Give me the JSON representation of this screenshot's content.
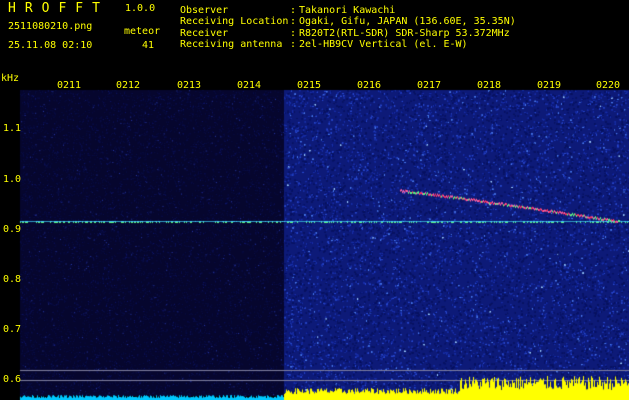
{
  "header": {
    "app_title": "HROFFT",
    "version": "1.0.0",
    "filename": "2511080210.png",
    "timestamp": "25.11.08 02:10",
    "meteor_label": "meteor",
    "meteor_count": "41"
  },
  "info": [
    {
      "label": "Observer",
      "colon": ":",
      "value": "Takanori Kawachi"
    },
    {
      "label": "Receiving Location",
      "colon": ":",
      "value": "Ogaki, Gifu, JAPAN (136.60E, 35.35N)"
    },
    {
      "label": "Receiver",
      "colon": ":",
      "value": "R820T2(RTL-SDR) SDR-Sharp 53.372MHz"
    },
    {
      "label": "Receiving antenna",
      "colon": ":",
      "value": "2el-HB9CV Vertical (el. E-W)"
    }
  ],
  "axis": {
    "y_unit": "kHz",
    "y_ticks": [
      "1.1",
      "1.0",
      "0.9",
      "0.8",
      "0.7",
      "0.6"
    ],
    "x_ticks": [
      "0211",
      "0212",
      "0213",
      "0214",
      "0215",
      "0216",
      "0217",
      "0218",
      "0219",
      "0220"
    ]
  },
  "colors": {
    "text": "#ffff00",
    "background": "#000000",
    "noise_dark": "#0a0a40",
    "noise_bright": "#1f3fc8",
    "carrier": "#40c8ff",
    "meteor_trace": "#ff60a0",
    "level_low": "#00c8ff",
    "level_high": "#ffff00"
  }
}
